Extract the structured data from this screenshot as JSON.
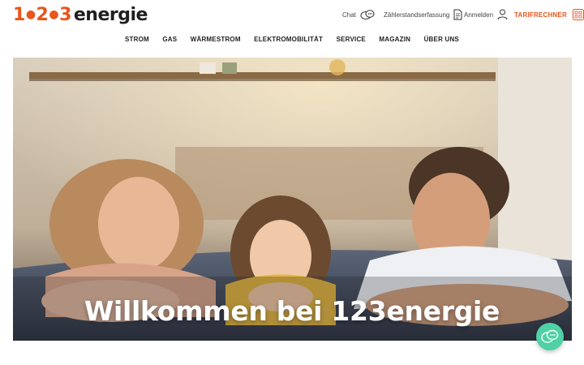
{
  "brand": {
    "logo_digits": [
      "1",
      "2",
      "3"
    ],
    "logo_word": "energie",
    "accent": "#e8561c"
  },
  "utility": {
    "chat_label": "Chat",
    "chat_icon": "chat-bubbles-icon",
    "meter_label": "Zählerstandserfassung",
    "meter_icon": "document-icon",
    "login_label": "Anmelden",
    "login_icon": "user-icon",
    "tarif_label": "TARIFRECHNER",
    "tarif_icon": "calculator-icon"
  },
  "nav": {
    "items": [
      "STROM",
      "GAS",
      "WÄRMESTROM",
      "ELEKTROMOBILITÄT",
      "SERVICE",
      "MAGAZIN",
      "ÜBER UNS"
    ]
  },
  "hero": {
    "title": "Willkommen bei 123energie"
  },
  "fab": {
    "icon": "chat-bubbles-icon",
    "color": "#4fd1a5"
  }
}
